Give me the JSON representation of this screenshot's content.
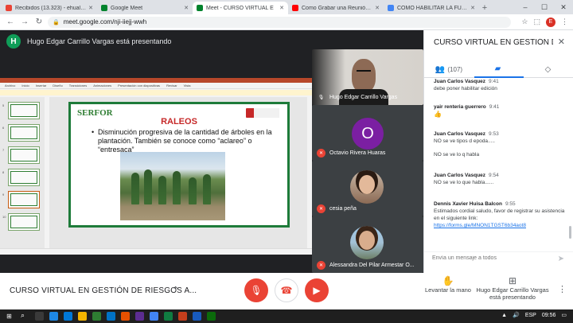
{
  "browser": {
    "tabs": [
      {
        "label": "Recibidos (13.323) - ehualpa@...",
        "icon": "gmail-icon",
        "color": "#ea4335"
      },
      {
        "label": "Google Meet",
        "icon": "meet-icon",
        "color": "#00832d"
      },
      {
        "label": "Meet - CURSO VIRTUAL E",
        "icon": "meet-icon",
        "color": "#00832d",
        "active": true
      },
      {
        "label": "Como Grabar una Reunión co...",
        "icon": "youtube-icon",
        "color": "#ff0000"
      },
      {
        "label": "COMO HABILITAR LA FUNCIÓ...",
        "icon": "google-icon",
        "color": "#4285f4"
      }
    ],
    "new_tab": "+",
    "url": "meet.google.com/nji-iiejj-wwh",
    "profile_initial": "E"
  },
  "meet": {
    "presenter_initial": "H",
    "presenter_banner": "Hugo Edgar Carrillo Vargas está presentando",
    "slide": {
      "brand": "SERFOR",
      "title": "RALEOS",
      "bullet": "Disminución progresiva de la cantidad de árboles en la plantación. También se conoce como “aclareo” o “entresaca”",
      "menu": [
        "Archivo",
        "Inicio",
        "Insertar",
        "Diseño",
        "Transiciones",
        "Animaciones",
        "Presentación con diapositivas",
        "Revisar",
        "Vista"
      ],
      "thumb_numbers": [
        "5",
        "6",
        "7",
        "8",
        "9",
        "10"
      ]
    },
    "participants": [
      {
        "name": "Hugo Edgar Carrillo Vargas",
        "type": "camera"
      },
      {
        "name": "Octavio Rivera Huaras",
        "type": "initial",
        "initial": "O",
        "color": "#7b1fa2"
      },
      {
        "name": "cesia peña",
        "type": "photo"
      },
      {
        "name": "Alessandra Del Pilar Armestar O...",
        "type": "photo"
      }
    ]
  },
  "bottom": {
    "meeting_name": "CURSO VIRTUAL EN GESTIÓN DE RIESGOS A...",
    "raise_hand": "Levantar la mano",
    "presenting_line1": "Hugo Edgar Carrillo Vargas",
    "presenting_line2": "está presentando"
  },
  "panel": {
    "title": "CURSO VIRTUAL EN GESTIÓN DE ...",
    "people_count": "(107)",
    "messages": [
      {
        "sender": "Juan Carlos Vasquez",
        "time": "9:41",
        "text": "debe poner habilitar edición"
      },
      {
        "sender": "yair renteria guerrero",
        "time": "9:41",
        "text": "👍"
      },
      {
        "sender": "Juan Carlos Vasquez",
        "time": "9:53",
        "text": "NO se ve tipos d epoda.....",
        "text2": "NO se ve lo q habla"
      },
      {
        "sender": "Juan Carlos Vasquez",
        "time": "9:54",
        "text": "NO se ve lo que habla......"
      },
      {
        "sender": "Dennis Xavier Huisa Balcon",
        "time": "9:55",
        "text": "Estimados cordial saludo, favor de registrar su asistencia en el siguiente link:",
        "link": "https://forms.gle/MNON1TGST6b34aot8"
      }
    ],
    "input_placeholder": "Envía un mensaje a todos"
  },
  "taskbar": {
    "lang": "ESP",
    "time": "09:56"
  }
}
